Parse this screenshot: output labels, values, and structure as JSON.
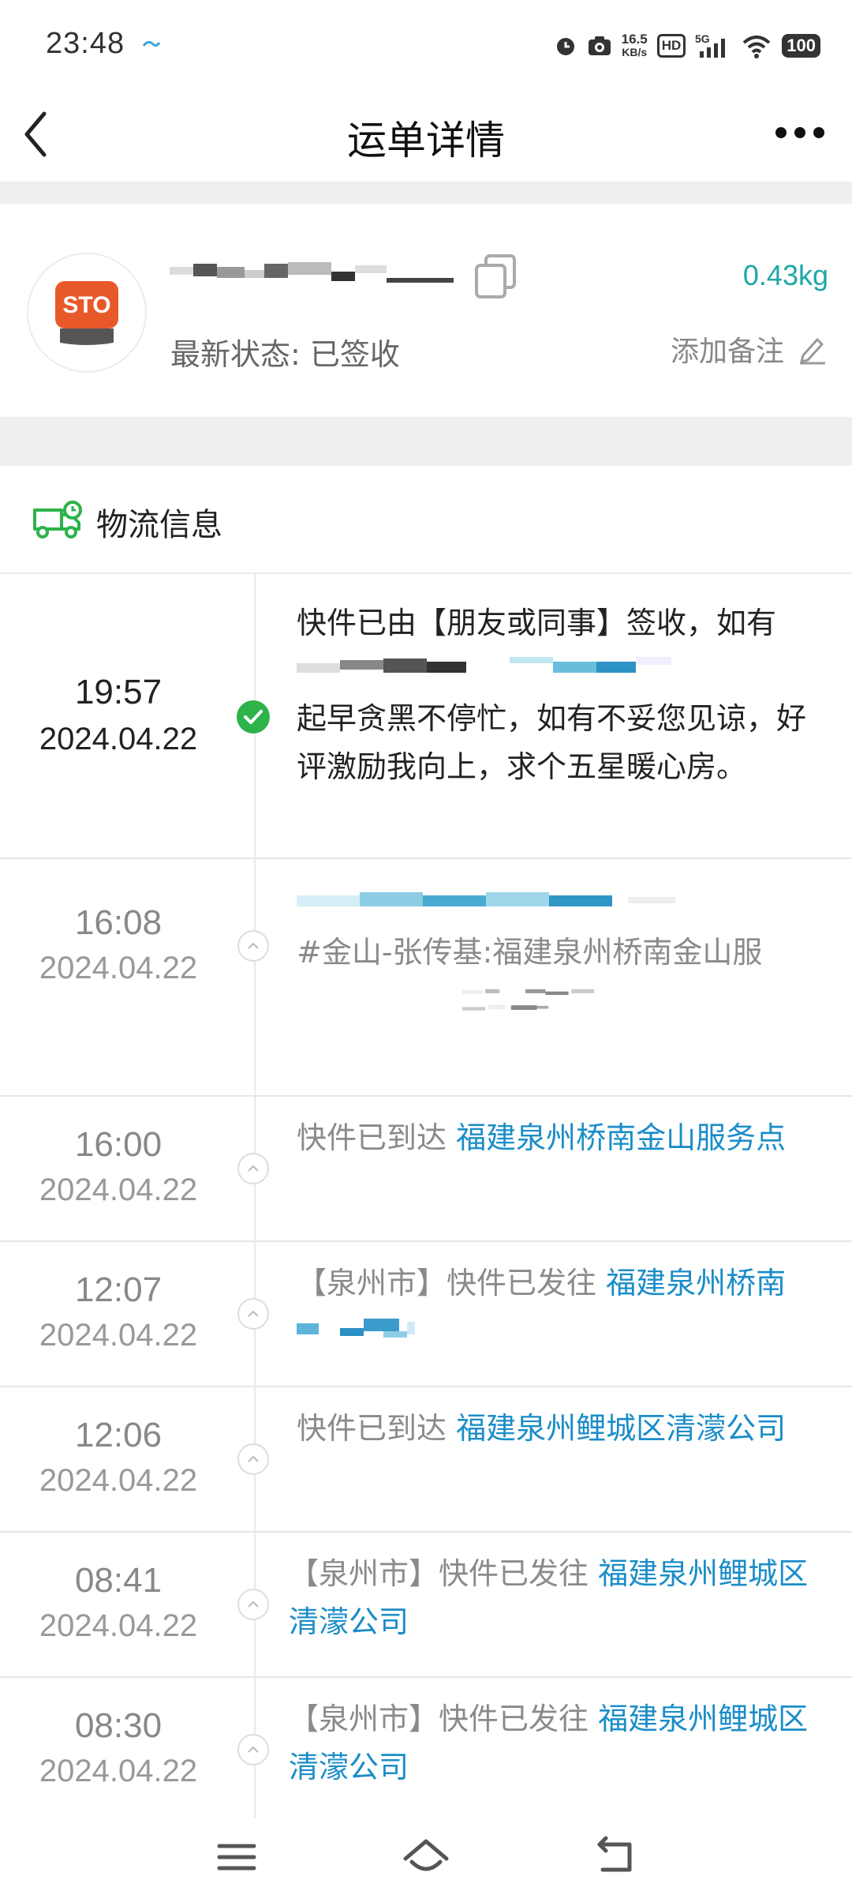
{
  "status_bar": {
    "time": "23:48",
    "net_speed_value": "16.5",
    "net_speed_unit": "KB/s",
    "hd": "HD",
    "network": "5G",
    "battery": "100"
  },
  "nav": {
    "title": "运单详情"
  },
  "waybill": {
    "carrier_logo_text": "STO",
    "weight": "0.43kg",
    "status": "最新状态: 已签收",
    "add_note": "添加备注"
  },
  "logistics": {
    "header": "物流信息",
    "entries": [
      {
        "time": "19:57",
        "date": "2024.04.22",
        "text_parts": [
          "快件已由【朋友或同事】签收，如有",
          "起早贪黑不停忙，如有不妥您见谅，好评激励我向上，求个五星暖心房。"
        ]
      },
      {
        "time": "16:08",
        "date": "2024.04.22",
        "text": "#金山-张传基:福建泉州桥南金山服"
      },
      {
        "time": "16:00",
        "date": "2024.04.22",
        "prefix": "快件已到达 ",
        "link": "福建泉州桥南金山服务点"
      },
      {
        "time": "12:07",
        "date": "2024.04.22",
        "prefix": "【泉州市】快件已发往 ",
        "link": "福建泉州桥南"
      },
      {
        "time": "12:06",
        "date": "2024.04.22",
        "prefix": "快件已到达 ",
        "link": "福建泉州鲤城区清濛公司"
      },
      {
        "time": "08:41",
        "date": "2024.04.22",
        "prefix": "【泉州市】快件已发往 ",
        "link": "福建泉州鲤城区清濛公司"
      },
      {
        "time": "08:30",
        "date": "2024.04.22",
        "prefix": "【泉州市】快件已发往 ",
        "link": "福建泉州鲤城区清濛公司"
      }
    ]
  },
  "colors": {
    "accent_teal": "#1fa6a6",
    "link_blue": "#1b8dc8",
    "signed_green": "#2db34a",
    "sto_orange": "#e8592a"
  }
}
